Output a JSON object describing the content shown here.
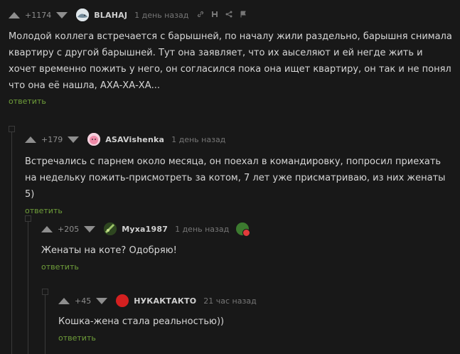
{
  "comments": [
    {
      "rating": "+1174",
      "username": "BLAHAJ",
      "date": "1 день назад",
      "text": "Молодой коллега встречается с барышней, по началу жили раздельно, барышня снимала квартиру с другой барышней. Тут она заявляет, что их аыселяют и ей негде жить и хочет временно пожить у него, он согласился пока она ищет квартиру, он так и не понял что она её нашла, АХА-ХА-ХА...",
      "reply": "ответить",
      "icons": [
        "link-icon",
        "save-icon",
        "share-icon",
        "flag-icon"
      ]
    },
    {
      "rating": "+179",
      "username": "ASAVishenka",
      "date": "1 день назад",
      "text": "Встречались с парнем около месяца, он поехал в командировку, попросил приехать на недельку пожить-присмотреть за котом, 7 лет уже присматриваю, из них женаты 5)",
      "reply": "ответить"
    },
    {
      "rating": "+205",
      "username": "Муха1987",
      "date": "1 день назад",
      "text": "Женаты на коте? Одобряю!",
      "reply": "ответить"
    },
    {
      "rating": "+45",
      "username": "НУКАКТАКТО",
      "date": "21 час назад",
      "text": "Кошка-жена стала реальностью))",
      "reply": "ответить"
    }
  ],
  "colors": {
    "background": "#181818",
    "text": "#d6d6d6",
    "muted": "#8e8e8e",
    "reply": "#6f9e3a",
    "avatar_red": "#d42020"
  }
}
